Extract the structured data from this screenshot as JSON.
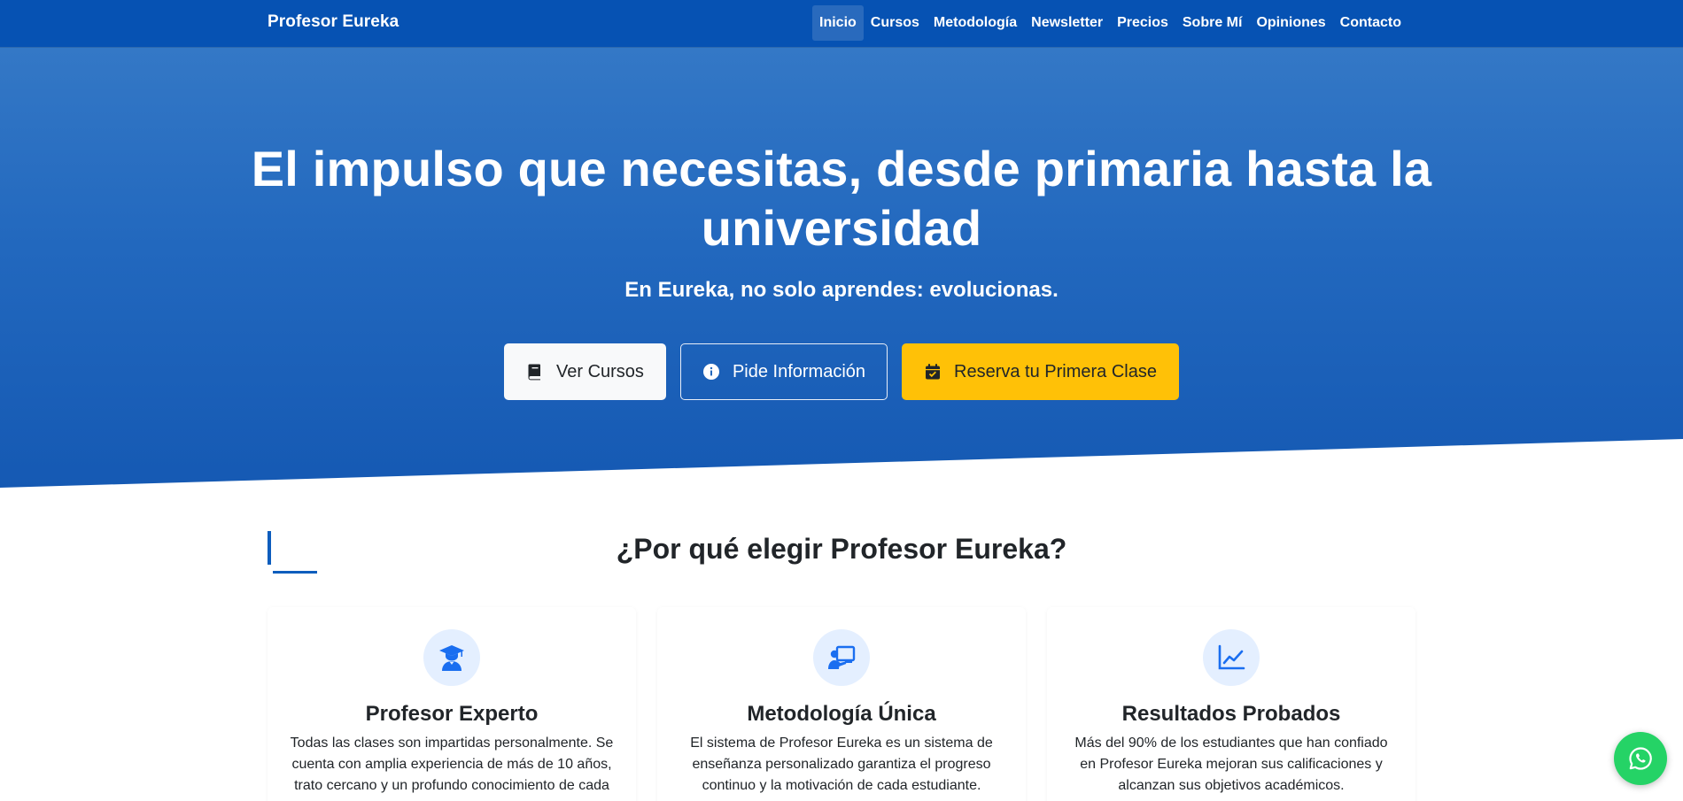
{
  "navbar": {
    "brand": "Profesor Eureka",
    "links": [
      {
        "label": "Inicio",
        "active": true
      },
      {
        "label": "Cursos"
      },
      {
        "label": "Metodología"
      },
      {
        "label": "Newsletter"
      },
      {
        "label": "Precios"
      },
      {
        "label": "Sobre Mí"
      },
      {
        "label": "Opiniones"
      },
      {
        "label": "Contacto"
      }
    ]
  },
  "hero": {
    "title": "El impulso que necesitas, desde primaria hasta la universidad",
    "subtitle": "En Eureka, no solo aprendes: evolucionas.",
    "buttons": [
      {
        "label": "Ver Cursos",
        "icon": "book-icon"
      },
      {
        "label": "Pide Información",
        "icon": "info-circle-icon"
      },
      {
        "label": "Reserva tu Primera Clase",
        "icon": "calendar-check-icon"
      }
    ]
  },
  "section": {
    "title": "¿Por qué elegir Profesor Eureka?",
    "cards": [
      {
        "icon": "graduate-icon",
        "title": "Profesor Experto",
        "text": "Todas las clases son impartidas personalmente. Se cuenta con amplia experiencia de más de 10 años, trato cercano y un profundo conocimiento de cada"
      },
      {
        "icon": "teacher-board-icon",
        "title": "Metodología Única",
        "text": "El sistema de Profesor Eureka es un sistema de enseñanza personalizado garantiza el progreso continuo y la motivación de cada estudiante."
      },
      {
        "icon": "chart-line-icon",
        "title": "Resultados Probados",
        "text": "Más del 90% de los estudiantes que han confiado en Profesor Eureka mejoran sus calificaciones y alcanzan sus objetivos académicos."
      }
    ]
  },
  "colors": {
    "navbar": "#0652b3",
    "hero_top": "#3478c6",
    "hero_bottom": "#1559b3",
    "accent": "#0d5dbd",
    "warning": "#ffc107",
    "icon_blue": "#1a6ef0",
    "icon_bg": "#e4efff",
    "whatsapp": "#25d366"
  },
  "whatsapp": {
    "icon": "whatsapp-icon"
  }
}
